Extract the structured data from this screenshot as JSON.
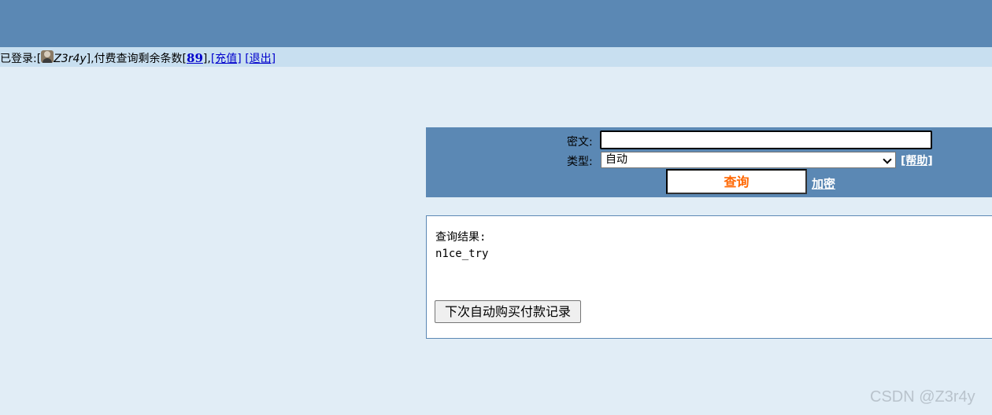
{
  "status_bar": {
    "logged_in_prefix": "已登录:[",
    "username": "Z3r4y",
    "remaining_text": "],付费查询剩余条数[",
    "remaining_count": "89",
    "after_count": "],",
    "recharge_label": "[充值]",
    "logout_label": "[退出]"
  },
  "query_form": {
    "ciphertext_label": "密文:",
    "ciphertext_value": "",
    "type_label": "类型:",
    "type_selected": "自动",
    "help_label": "[帮助]",
    "submit_label": "查询",
    "encrypt_label": "加密"
  },
  "result": {
    "title": "查询结果:",
    "value": "n1ce_try",
    "buy_button_label": "下次自动购买付款记录"
  },
  "watermark": "CSDN @Z3r4y",
  "colors": {
    "header_bg": "#5b88b4",
    "status_bg": "#c8dff0",
    "page_bg": "#e1edf6",
    "query_text": "#ff6600"
  }
}
